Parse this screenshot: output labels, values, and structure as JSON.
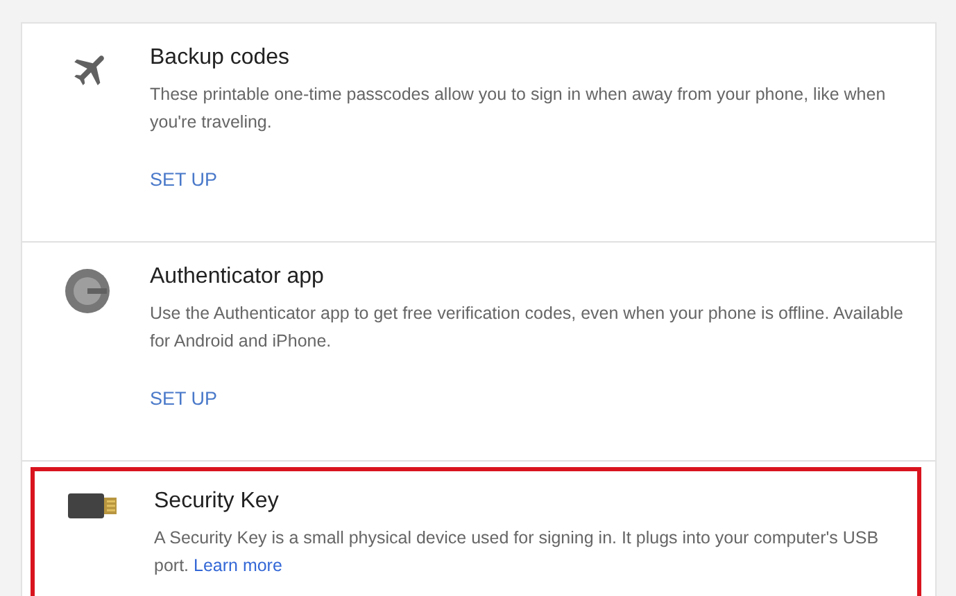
{
  "options": [
    {
      "kind": "plane",
      "title": "Backup codes",
      "description": "These printable one-time passcodes allow you to sign in when away from your phone, like when you're traveling.",
      "action": "SET UP",
      "highlighted": false
    },
    {
      "kind": "authenticator",
      "title": "Authenticator app",
      "description": "Use the Authenticator app to get free verification codes, even when your phone is offline. Available for Android and iPhone.",
      "action": "SET UP",
      "highlighted": false
    },
    {
      "kind": "usb-key",
      "title": "Security Key",
      "description": "A Security Key is a small physical device used for signing in. It plugs into your computer's USB port.",
      "link": "Learn more",
      "highlighted": true
    }
  ]
}
